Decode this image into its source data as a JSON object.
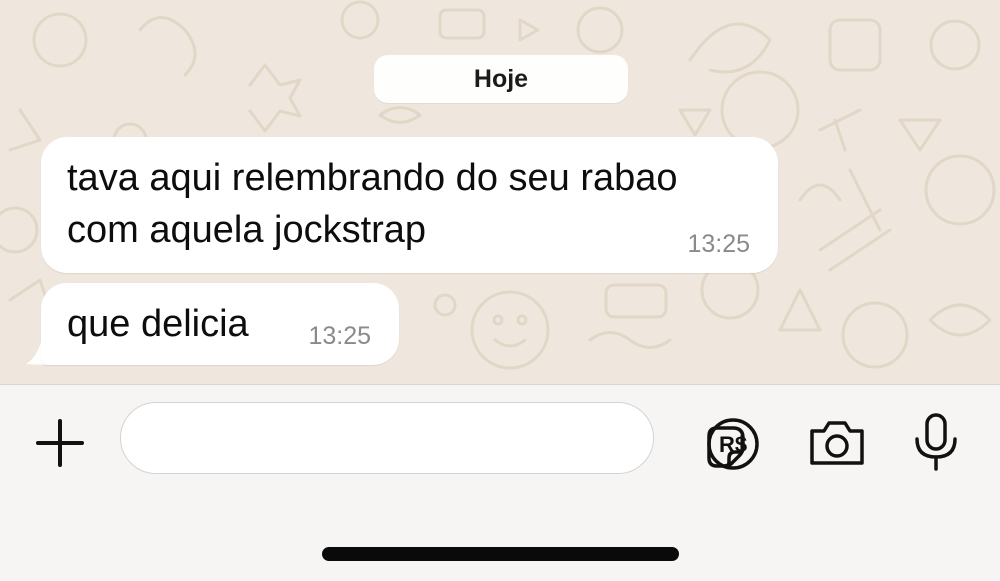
{
  "chat": {
    "date_label": "Hoje",
    "messages": [
      {
        "text": "tava aqui relembrando do seu rabao\ncom aquela jockstrap",
        "time": "13:25"
      },
      {
        "text": "que delicia",
        "time": "13:25"
      }
    ]
  },
  "composer": {
    "message_value": "",
    "icons": {
      "attach": "plus-icon",
      "sticker": "sticker-icon",
      "payment": "pix-payment-icon",
      "camera": "camera-icon",
      "voice": "microphone-icon"
    }
  },
  "colors": {
    "chat_background": "#efe7dd",
    "bubble": "#ffffff",
    "timestamp": "#8a8a8a",
    "toolbar": "#f6f5f3"
  }
}
